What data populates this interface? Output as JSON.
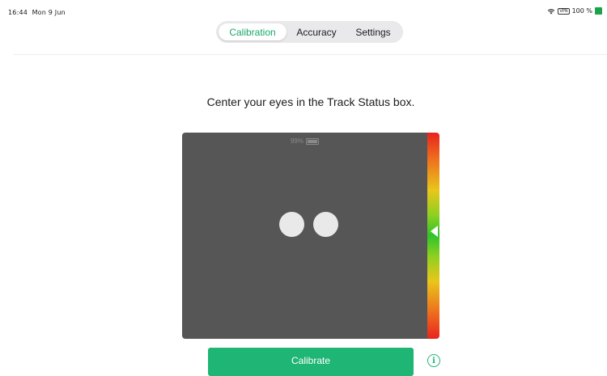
{
  "status_bar": {
    "time": "16:44",
    "date": "Mon 9 Jun",
    "vpn": "VPN",
    "battery_percent": "100 %",
    "icons": [
      "wifi-icon",
      "vpn-badge",
      "battery-icon"
    ]
  },
  "tabs": [
    {
      "label": "Calibration",
      "selected": true
    },
    {
      "label": "Accuracy",
      "selected": false
    },
    {
      "label": "Settings",
      "selected": false
    }
  ],
  "instruction": "Center your eyes in the Track Status box.",
  "track_status": {
    "readout": "99%",
    "eyes_detected": 2,
    "distance_indicator": "center"
  },
  "actions": {
    "calibrate_label": "Calibrate",
    "info_symbol": "i"
  },
  "colors": {
    "accent": "#1fb574",
    "track_box_bg": "#565656",
    "eye_fill": "#e9e9e9",
    "bar_red": "#e8231f",
    "bar_yellow": "#e9c61a",
    "bar_green": "#2fc42a"
  }
}
